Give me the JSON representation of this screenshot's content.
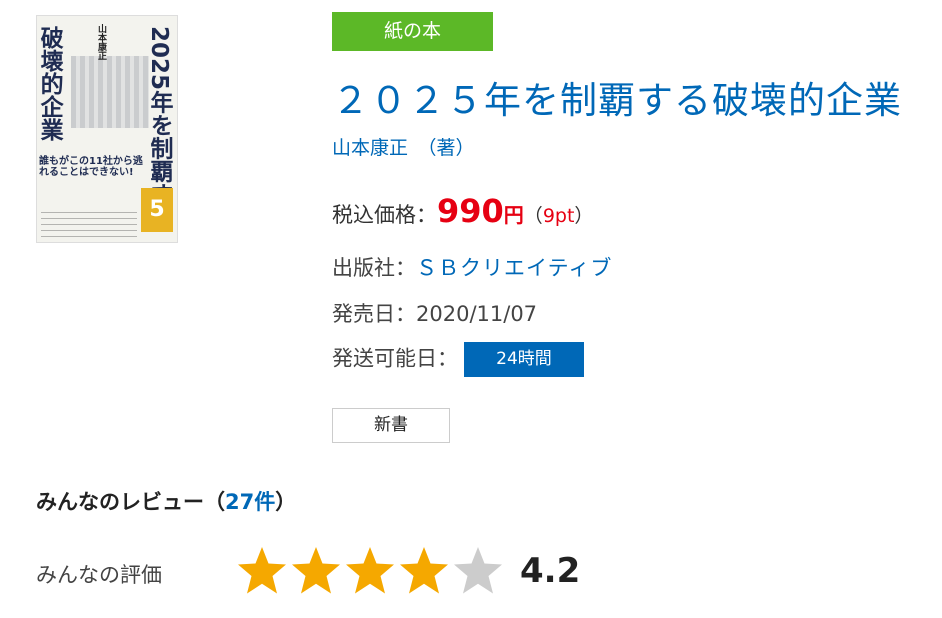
{
  "cover": {
    "title_line1": "破壊的企業",
    "title_line2": "2025年を制覇する",
    "author": "山本康正",
    "blurb": "誰もがこの11社から逃れることはできない!",
    "badge": "5"
  },
  "format_tag": "紙の本",
  "book": {
    "title": "２０２５年を制覇する破壊的企業",
    "author": "山本康正　（著）"
  },
  "price": {
    "label": "税込価格：",
    "value": "990",
    "unit": "円",
    "points_open": "（",
    "points": "9pt",
    "points_close": "）"
  },
  "publisher": {
    "label": "出版社：",
    "value": "ＳＢクリエイティブ"
  },
  "release": {
    "label": "発売日：",
    "value": "2020/11/07"
  },
  "shipping": {
    "label": "発送可能日：",
    "value": "24時間"
  },
  "category_tag": "新書",
  "reviews": {
    "heading": "みんなのレビュー（",
    "count": "27件",
    "heading_close": "）",
    "rating_label": "みんなの評価",
    "rating": 4.2,
    "rating_text": "4.2",
    "star_color": "#f5a800",
    "star_empty_color": "#cccccc"
  }
}
